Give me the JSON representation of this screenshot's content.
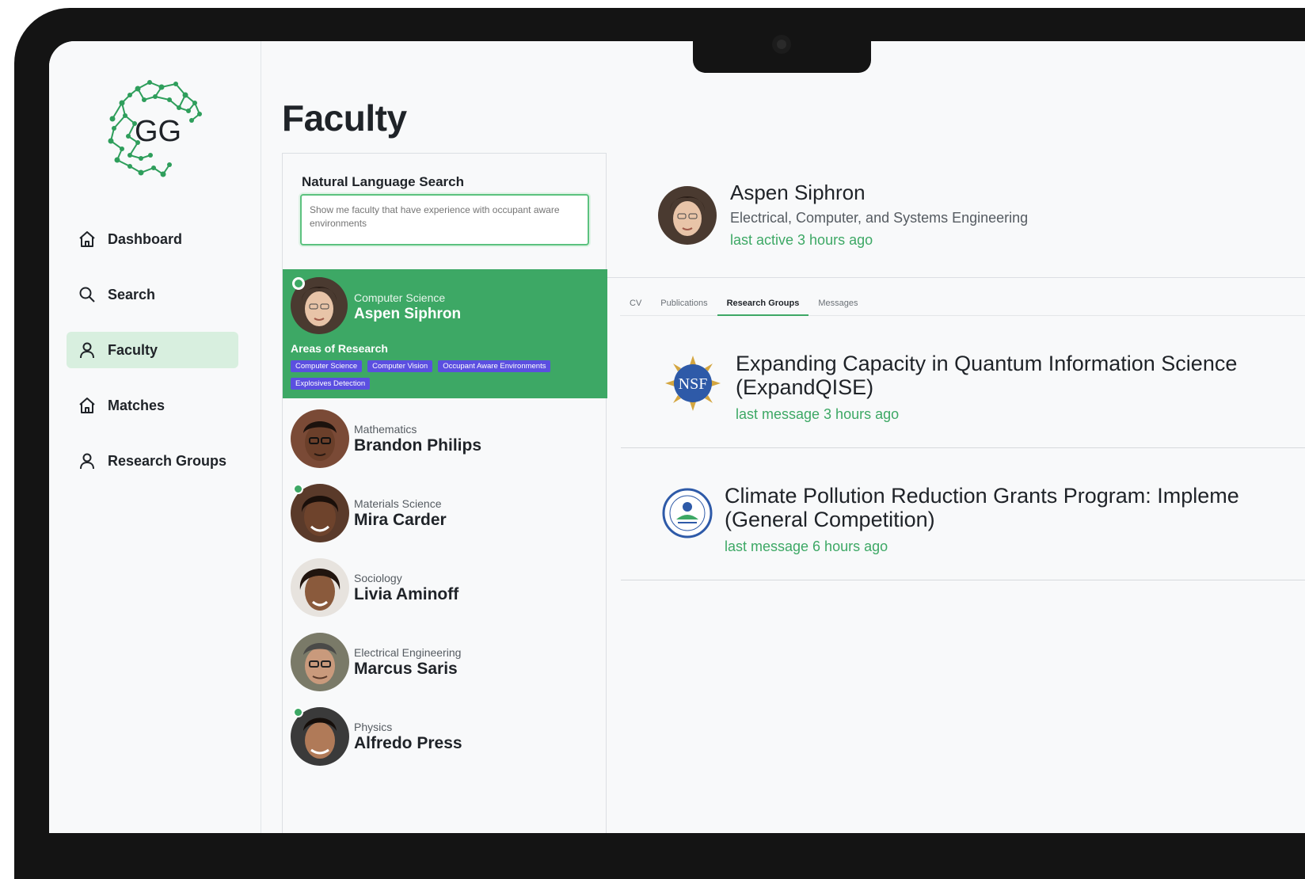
{
  "sidebar": {
    "logo_text": "GG",
    "items": [
      {
        "label": "Dashboard",
        "icon": "home-icon"
      },
      {
        "label": "Search",
        "icon": "search-icon"
      },
      {
        "label": "Faculty",
        "icon": "user-icon",
        "active": true
      },
      {
        "label": "Matches",
        "icon": "home-icon"
      },
      {
        "label": "Research Groups",
        "icon": "user-icon"
      }
    ]
  },
  "page": {
    "title": "Faculty"
  },
  "search": {
    "label": "Natural Language Search",
    "placeholder": "Show me faculty that have experience with occupant aware environments"
  },
  "faculty_list": {
    "selected": {
      "department": "Computer Science",
      "name": "Aspen Siphron",
      "areas_label": "Areas of Research",
      "areas": [
        "Computer Science",
        "Computer Vision",
        "Occupant Aware Environments",
        "Explosives Detection"
      ]
    },
    "items": [
      {
        "department": "Mathematics",
        "name": "Brandon Philips",
        "online": false
      },
      {
        "department": "Materials Science",
        "name": "Mira Carder",
        "online": true
      },
      {
        "department": "Sociology",
        "name": "Livia Aminoff",
        "online": false
      },
      {
        "department": "Electrical Engineering",
        "name": "Marcus Saris",
        "online": false
      },
      {
        "department": "Physics",
        "name": "Alfredo Press",
        "online": true
      }
    ]
  },
  "detail": {
    "name": "Aspen Siphron",
    "department": "Electrical, Computer, and Systems Engineering",
    "last_active": "last active 3 hours ago",
    "tabs": [
      "CV",
      "Publications",
      "Research Groups",
      "Messages"
    ],
    "active_tab": "Research Groups",
    "groups": [
      {
        "logo": "NSF",
        "title_line1": "Expanding Capacity in Quantum Information Science",
        "title_line2": "(ExpandQISE)",
        "last_message": "last message 3 hours ago"
      },
      {
        "logo": "epa-seal-icon",
        "title_line1": "Climate Pollution Reduction Grants Program: Impleme",
        "title_line2": "(General Competition)",
        "last_message": "last message 6 hours ago"
      }
    ]
  },
  "colors": {
    "accent": "#3da865",
    "tag": "#5b4fe0",
    "active_nav": "#d8efdf"
  }
}
